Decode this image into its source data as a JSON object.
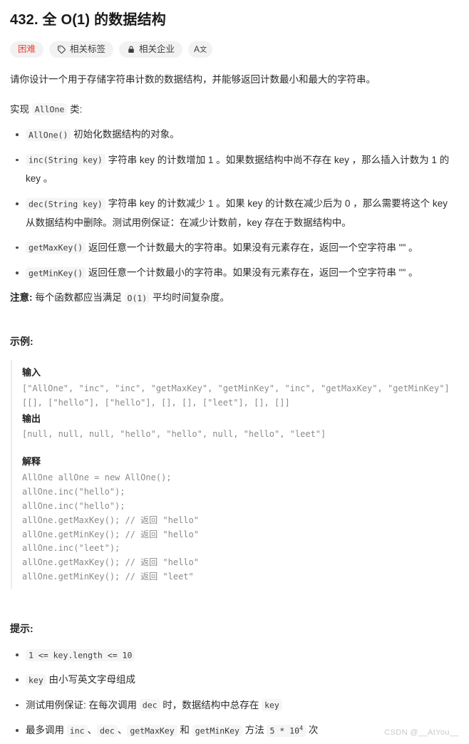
{
  "title": "432. 全 O(1) 的数据结构",
  "badges": [
    {
      "label": "困难",
      "icon": "none",
      "kind": "difficulty"
    },
    {
      "label": "相关标签",
      "icon": "tag-icon",
      "kind": "normal"
    },
    {
      "label": "相关企业",
      "icon": "lock-icon",
      "kind": "normal"
    },
    {
      "label": "Aa",
      "icon": "translate-icon",
      "kind": "icon-only"
    }
  ],
  "intro": {
    "paragraph": "请你设计一个用于存储字符串计数的数据结构，并能够返回计数最小和最大的字符串。",
    "implement_prefix": "实现 ",
    "implement_code": "AllOne",
    "implement_suffix": " 类:"
  },
  "methods": [
    {
      "code": "AllOne()",
      "text": " 初始化数据结构的对象。"
    },
    {
      "code": "inc(String key)",
      "text": " 字符串 key 的计数增加 1 。如果数据结构中尚不存在 key ，那么插入计数为 1 的 key 。"
    },
    {
      "code": "dec(String key)",
      "text": " 字符串 key 的计数减少 1 。如果 key 的计数在减少后为 0 ，那么需要将这个 key 从数据结构中删除。测试用例保证：在减少计数前，key 存在于数据结构中。"
    },
    {
      "code": "getMaxKey()",
      "text": " 返回任意一个计数最大的字符串。如果没有元素存在，返回一个空字符串 \"\" 。"
    },
    {
      "code": "getMinKey()",
      "text": " 返回任意一个计数最小的字符串。如果没有元素存在，返回一个空字符串 \"\" 。"
    }
  ],
  "note": {
    "label": "注意:",
    "text_before": " 每个函数都应当满足 ",
    "code": "O(1)",
    "text_after": " 平均时间复杂度。"
  },
  "example": {
    "heading": "示例:",
    "input_label": "输入",
    "input_lines": "[\"AllOne\", \"inc\", \"inc\", \"getMaxKey\", \"getMinKey\", \"inc\", \"getMaxKey\", \"getMinKey\"]\n[[], [\"hello\"], [\"hello\"], [], [], [\"leet\"], [], []]",
    "output_label": "输出",
    "output_lines": "[null, null, null, \"hello\", \"hello\", null, \"hello\", \"leet\"]",
    "explain_label": "解释",
    "explain_lines": "AllOne allOne = new AllOne();\nallOne.inc(\"hello\");\nallOne.inc(\"hello\");\nallOne.getMaxKey(); // 返回 \"hello\"\nallOne.getMinKey(); // 返回 \"hello\"\nallOne.inc(\"leet\");\nallOne.getMaxKey(); // 返回 \"hello\"\nallOne.getMinKey(); // 返回 \"leet\""
  },
  "hints": {
    "heading": "提示:",
    "items": [
      {
        "type": "code-only",
        "code": "1 <= key.length <= 10"
      },
      {
        "type": "code-first",
        "code": "key",
        "text": " 由小写英文字母组成"
      },
      {
        "type": "mixed",
        "pre": "测试用例保证: 在每次调用 ",
        "code1": "dec",
        "mid": " 时，数据结构中总存在 ",
        "code2": "key"
      },
      {
        "type": "calls",
        "pre": "最多调用 ",
        "c1": "inc",
        "sep1": "、",
        "c2": "dec",
        "sep2": "、",
        "c3": "getMaxKey",
        "and": " 和 ",
        "c4": "getMinKey",
        "mid": " 方法 ",
        "count_base": "5 * 10",
        "count_exp": "4",
        "suffix": " 次"
      }
    ]
  },
  "watermark": "CSDN @__AtYou__",
  "colors": {
    "difficulty": "#e8453c",
    "code_bg": "#f5f5f5",
    "badge_bg": "#f2f2f2",
    "example_border": "#ececec",
    "muted_text": "#8a8a8a"
  }
}
